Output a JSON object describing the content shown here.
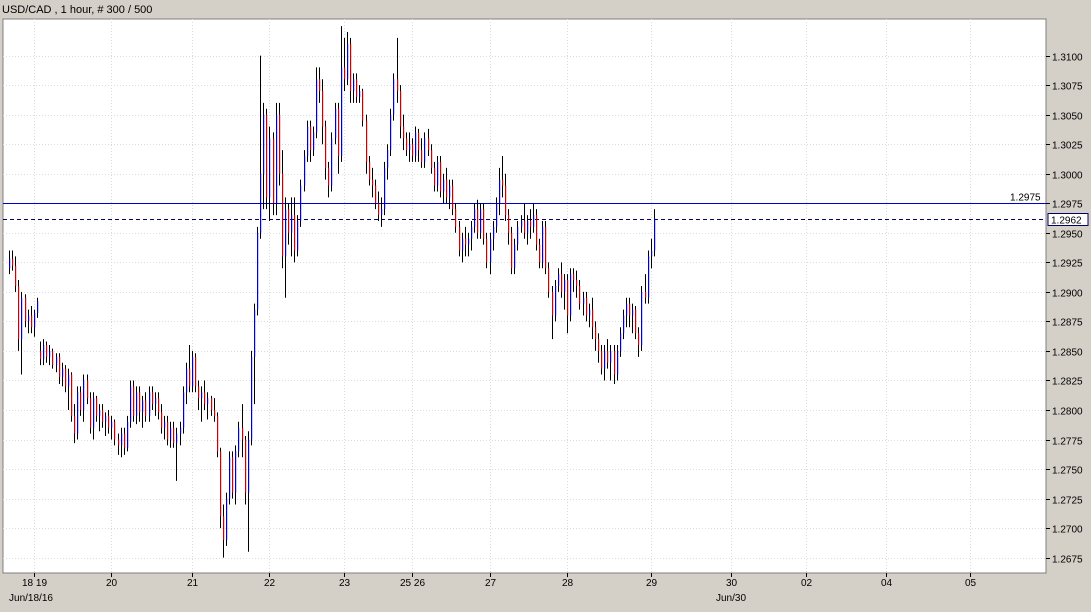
{
  "chart_data": {
    "type": "ohlc",
    "title": "USD/CAD , 1 hour, # 300 / 500",
    "ylim": [
      1.2662,
      1.3131
    ],
    "grid": true,
    "y_ticks": [
      "1.3100",
      "1.3075",
      "1.3050",
      "1.3025",
      "1.3000",
      "1.2975",
      "1.2950",
      "1.2925",
      "1.2900",
      "1.2875",
      "1.2850",
      "1.2825",
      "1.2800",
      "1.2775",
      "1.2750",
      "1.2725",
      "1.2700",
      "1.2675"
    ],
    "x_labels": [
      {
        "label": "18 19",
        "bar": 8
      },
      {
        "label": "20",
        "bar": 33
      },
      {
        "label": "21",
        "bar": 59
      },
      {
        "label": "22",
        "bar": 84
      },
      {
        "label": "23",
        "bar": 108
      },
      {
        "label": "25 26",
        "bar": 130
      },
      {
        "label": "27",
        "bar": 155
      },
      {
        "label": "28",
        "bar": 180
      },
      {
        "label": "29",
        "bar": 207
      },
      {
        "label": "30",
        "bar": 233
      },
      {
        "label": "02",
        "bar": 257
      },
      {
        "label": "04",
        "bar": 283
      },
      {
        "label": "05",
        "bar": 310
      }
    ],
    "x_labels2": [
      {
        "label": "Jun/18/16",
        "bar": 7
      },
      {
        "label": "Jun/30",
        "bar": 233
      }
    ],
    "reference_lines": [
      {
        "value": 1.2975,
        "label": "1.2975",
        "color": "#0000cc",
        "style": "solid"
      },
      {
        "value": 1.2962,
        "label": "1.2962",
        "color": "#000066",
        "style": "dashed"
      }
    ],
    "up_color": "#0000cc",
    "down_color": "#cc0000",
    "bars": [
      [
        1.292,
        1.2935,
        1.2915,
        1.2928
      ],
      [
        1.2928,
        1.2935,
        1.2918,
        1.2922
      ],
      [
        1.2922,
        1.293,
        1.29,
        1.2905
      ],
      [
        1.2905,
        1.291,
        1.285,
        1.286
      ],
      [
        1.286,
        1.29,
        1.283,
        1.2895
      ],
      [
        1.2895,
        1.2898,
        1.287,
        1.2875
      ],
      [
        1.2875,
        1.2885,
        1.2865,
        1.288
      ],
      [
        1.288,
        1.2888,
        1.2865,
        1.287
      ],
      [
        1.287,
        1.2885,
        1.2862,
        1.2882
      ],
      [
        1.2882,
        1.2895,
        1.2878,
        1.2892
      ],
      [
        1.285,
        1.2858,
        1.2838,
        1.2843
      ],
      [
        1.2843,
        1.286,
        1.2838,
        1.2855
      ],
      [
        1.2855,
        1.2858,
        1.284,
        1.2845
      ],
      [
        1.2845,
        1.2855,
        1.2838,
        1.285
      ],
      [
        1.285,
        1.2852,
        1.2835,
        1.2838
      ],
      [
        1.2838,
        1.2848,
        1.2832,
        1.2845
      ],
      [
        1.2845,
        1.2848,
        1.2822,
        1.2828
      ],
      [
        1.2828,
        1.284,
        1.282,
        1.2835
      ],
      [
        1.2835,
        1.2838,
        1.2815,
        1.282
      ],
      [
        1.282,
        1.2835,
        1.28,
        1.283
      ],
      [
        1.283,
        1.2832,
        1.279,
        1.2795
      ],
      [
        1.2795,
        1.2805,
        1.2772,
        1.278
      ],
      [
        1.278,
        1.282,
        1.2775,
        1.2815
      ],
      [
        1.2815,
        1.282,
        1.2795,
        1.28
      ],
      [
        1.28,
        1.283,
        1.279,
        1.2825
      ],
      [
        1.2825,
        1.283,
        1.2805,
        1.281
      ],
      [
        1.281,
        1.2815,
        1.278,
        1.2785
      ],
      [
        1.2785,
        1.2815,
        1.2775,
        1.281
      ],
      [
        1.281,
        1.2812,
        1.279,
        1.2795
      ],
      [
        1.2795,
        1.2805,
        1.2782,
        1.28
      ],
      [
        1.28,
        1.2805,
        1.2785,
        1.279
      ],
      [
        1.279,
        1.2798,
        1.2778,
        1.2795
      ],
      [
        1.2795,
        1.28,
        1.278,
        1.2785
      ],
      [
        1.2785,
        1.2795,
        1.2775,
        1.279
      ],
      [
        1.279,
        1.2792,
        1.277,
        1.2775
      ],
      [
        1.2775,
        1.278,
        1.2762,
        1.277
      ],
      [
        1.277,
        1.2785,
        1.276,
        1.278
      ],
      [
        1.278,
        1.2785,
        1.2762,
        1.2768
      ],
      [
        1.2768,
        1.2795,
        1.2765,
        1.279
      ],
      [
        1.279,
        1.2825,
        1.2785,
        1.282
      ],
      [
        1.282,
        1.2825,
        1.279,
        1.2795
      ],
      [
        1.2795,
        1.282,
        1.2788,
        1.2815
      ],
      [
        1.2815,
        1.282,
        1.279,
        1.2798
      ],
      [
        1.2798,
        1.2812,
        1.2785,
        1.2808
      ],
      [
        1.2808,
        1.2815,
        1.279,
        1.2795
      ],
      [
        1.2795,
        1.282,
        1.279,
        1.2815
      ],
      [
        1.2815,
        1.282,
        1.28,
        1.2805
      ],
      [
        1.2805,
        1.2815,
        1.2795,
        1.281
      ],
      [
        1.281,
        1.2815,
        1.2792,
        1.2798
      ],
      [
        1.2798,
        1.2805,
        1.278,
        1.2785
      ],
      [
        1.2785,
        1.2795,
        1.2775,
        1.279
      ],
      [
        1.279,
        1.2795,
        1.277,
        1.2775
      ],
      [
        1.2775,
        1.279,
        1.2768,
        1.2785
      ],
      [
        1.2785,
        1.279,
        1.2768,
        1.2772
      ],
      [
        1.2772,
        1.2785,
        1.274,
        1.278
      ],
      [
        1.278,
        1.279,
        1.277,
        1.2785
      ],
      [
        1.2785,
        1.282,
        1.278,
        1.2815
      ],
      [
        1.2815,
        1.284,
        1.2805,
        1.2835
      ],
      [
        1.2835,
        1.2855,
        1.2815,
        1.282
      ],
      [
        1.282,
        1.285,
        1.2815,
        1.2845
      ],
      [
        1.2845,
        1.2848,
        1.2815,
        1.282
      ],
      [
        1.282,
        1.2825,
        1.28,
        1.281
      ],
      [
        1.281,
        1.282,
        1.279,
        1.2815
      ],
      [
        1.2815,
        1.2825,
        1.28,
        1.2805
      ],
      [
        1.2805,
        1.2815,
        1.2792,
        1.281
      ],
      [
        1.281,
        1.2812,
        1.2795,
        1.28
      ],
      [
        1.28,
        1.281,
        1.279,
        1.2795
      ],
      [
        1.2795,
        1.2798,
        1.276,
        1.2765
      ],
      [
        1.2765,
        1.2768,
        1.27,
        1.271
      ],
      [
        1.271,
        1.272,
        1.2675,
        1.269
      ],
      [
        1.269,
        1.273,
        1.2685,
        1.2725
      ],
      [
        1.2725,
        1.2765,
        1.272,
        1.276
      ],
      [
        1.276,
        1.2765,
        1.2725,
        1.273
      ],
      [
        1.273,
        1.277,
        1.272,
        1.2765
      ],
      [
        1.2765,
        1.279,
        1.276,
        1.2785
      ],
      [
        1.2785,
        1.2805,
        1.276,
        1.2775
      ],
      [
        1.2775,
        1.2778,
        1.272,
        1.273
      ],
      [
        1.273,
        1.2782,
        1.268,
        1.2775
      ],
      [
        1.2775,
        1.285,
        1.277,
        1.2845
      ],
      [
        1.2845,
        1.289,
        1.2805,
        1.2885
      ],
      [
        1.2885,
        1.2955,
        1.288,
        1.295
      ],
      [
        1.295,
        1.31,
        1.2945,
        1.3
      ],
      [
        1.3,
        1.306,
        1.297,
        1.305
      ],
      [
        1.305,
        1.3055,
        1.297,
        1.298
      ],
      [
        1.298,
        1.304,
        1.296,
        1.303
      ],
      [
        1.303,
        1.3035,
        1.2965,
        1.2975
      ],
      [
        1.2975,
        1.306,
        1.2965,
        1.305
      ],
      [
        1.305,
        1.306,
        1.299,
        1.3
      ],
      [
        1.3,
        1.302,
        1.292,
        1.293
      ],
      [
        1.293,
        1.298,
        1.2895,
        1.297
      ],
      [
        1.297,
        1.2975,
        1.294,
        1.295
      ],
      [
        1.295,
        1.298,
        1.293,
        1.2965
      ],
      [
        1.2965,
        1.298,
        1.2925,
        1.2935
      ],
      [
        1.2935,
        1.2965,
        1.293,
        1.296
      ],
      [
        1.296,
        1.2995,
        1.2955,
        1.299
      ],
      [
        1.299,
        1.302,
        1.2985,
        1.3015
      ],
      [
        1.3015,
        1.3045,
        1.301,
        1.304
      ],
      [
        1.304,
        1.3045,
        1.301,
        1.302
      ],
      [
        1.302,
        1.304,
        1.3015,
        1.3035
      ],
      [
        1.3035,
        1.309,
        1.303,
        1.308
      ],
      [
        1.308,
        1.309,
        1.306,
        1.307
      ],
      [
        1.307,
        1.308,
        1.3025,
        1.304
      ],
      [
        1.304,
        1.3045,
        1.2995,
        1.3005
      ],
      [
        1.3005,
        1.301,
        1.298,
        1.299
      ],
      [
        1.299,
        1.3035,
        1.2985,
        1.303
      ],
      [
        1.303,
        1.306,
        1.3025,
        1.3055
      ],
      [
        1.3055,
        1.306,
        1.3,
        1.3015
      ],
      [
        1.3015,
        1.3125,
        1.301,
        1.309
      ],
      [
        1.309,
        1.3115,
        1.307,
        1.308
      ],
      [
        1.308,
        1.312,
        1.3075,
        1.311
      ],
      [
        1.311,
        1.3115,
        1.306,
        1.307
      ],
      [
        1.307,
        1.3085,
        1.306,
        1.308
      ],
      [
        1.308,
        1.3085,
        1.306,
        1.3065
      ],
      [
        1.3065,
        1.3075,
        1.306,
        1.307
      ],
      [
        1.307,
        1.3072,
        1.304,
        1.3045
      ],
      [
        1.3045,
        1.305,
        1.3,
        1.301
      ],
      [
        1.301,
        1.3015,
        1.299,
        1.2995
      ],
      [
        1.2995,
        1.3005,
        1.298,
        1.299
      ],
      [
        1.299,
        1.2995,
        1.297,
        1.2975
      ],
      [
        1.2975,
        1.2985,
        1.296,
        1.2965
      ],
      [
        1.2965,
        1.298,
        1.2955,
        1.297
      ],
      [
        1.297,
        1.301,
        1.2965,
        1.3005
      ],
      [
        1.3005,
        1.3025,
        1.2995,
        1.302
      ],
      [
        1.302,
        1.3055,
        1.3015,
        1.305
      ],
      [
        1.305,
        1.3085,
        1.3045,
        1.308
      ],
      [
        1.308,
        1.3115,
        1.306,
        1.307
      ],
      [
        1.307,
        1.3075,
        1.303,
        1.304
      ],
      [
        1.304,
        1.305,
        1.302,
        1.303
      ],
      [
        1.303,
        1.3035,
        1.3015,
        1.302
      ],
      [
        1.302,
        1.3035,
        1.301,
        1.3025
      ],
      [
        1.3025,
        1.303,
        1.301,
        1.3015
      ],
      [
        1.3015,
        1.304,
        1.301,
        1.3035
      ],
      [
        1.3035,
        1.3038,
        1.301,
        1.302
      ],
      [
        1.302,
        1.303,
        1.3005,
        1.301
      ],
      [
        1.301,
        1.3035,
        1.3005,
        1.303
      ],
      [
        1.303,
        1.3038,
        1.3015,
        1.302
      ],
      [
        1.302,
        1.3025,
        1.3,
        1.3005
      ],
      [
        1.3005,
        1.301,
        1.2985,
        1.299
      ],
      [
        1.299,
        1.3015,
        1.2985,
        1.301
      ],
      [
        1.301,
        1.3015,
        1.298,
        1.2985
      ],
      [
        1.2985,
        1.3,
        1.2975,
        1.2995
      ],
      [
        1.2995,
        1.3005,
        1.2975,
        1.298
      ],
      [
        1.298,
        1.2995,
        1.297,
        1.299
      ],
      [
        1.299,
        1.2995,
        1.2965,
        1.297
      ],
      [
        1.297,
        1.2975,
        1.295,
        1.2955
      ],
      [
        1.2955,
        1.296,
        1.293,
        1.2935
      ],
      [
        1.2935,
        1.295,
        1.2925,
        1.2945
      ],
      [
        1.2945,
        1.2955,
        1.293,
        1.294
      ],
      [
        1.294,
        1.295,
        1.293,
        1.2945
      ],
      [
        1.2945,
        1.296,
        1.2935,
        1.2955
      ],
      [
        1.2955,
        1.2975,
        1.295,
        1.297
      ],
      [
        1.297,
        1.2978,
        1.2945,
        1.295
      ],
      [
        1.295,
        1.2975,
        1.2945,
        1.297
      ],
      [
        1.297,
        1.2975,
        1.294,
        1.2945
      ],
      [
        1.2945,
        1.295,
        1.292,
        1.2925
      ],
      [
        1.2925,
        1.295,
        1.2915,
        1.2945
      ],
      [
        1.2945,
        1.296,
        1.2935,
        1.2955
      ],
      [
        1.2955,
        1.298,
        1.295,
        1.2975
      ],
      [
        1.2975,
        1.3005,
        1.2965,
        1.2995
      ],
      [
        1.2995,
        1.3015,
        1.298,
        1.299
      ],
      [
        1.299,
        1.3,
        1.296,
        1.2965
      ],
      [
        1.2965,
        1.297,
        1.294,
        1.295
      ],
      [
        1.295,
        1.2955,
        1.2915,
        1.292
      ],
      [
        1.292,
        1.2945,
        1.2915,
        1.294
      ],
      [
        1.294,
        1.296,
        1.2935,
        1.2955
      ],
      [
        1.2955,
        1.2965,
        1.295,
        1.296
      ],
      [
        1.296,
        1.2975,
        1.2945,
        1.295
      ],
      [
        1.295,
        1.2965,
        1.294,
        1.296
      ],
      [
        1.296,
        1.297,
        1.2945,
        1.2955
      ],
      [
        1.2955,
        1.2975,
        1.295,
        1.2965
      ],
      [
        1.2965,
        1.297,
        1.2935,
        1.294
      ],
      [
        1.294,
        1.2945,
        1.292,
        1.2925
      ],
      [
        1.2925,
        1.296,
        1.292,
        1.2955
      ],
      [
        1.2955,
        1.296,
        1.2915,
        1.292
      ],
      [
        1.292,
        1.2925,
        1.2895,
        1.29
      ],
      [
        1.29,
        1.2905,
        1.286,
        1.288
      ],
      [
        1.288,
        1.291,
        1.2875,
        1.2905
      ],
      [
        1.2905,
        1.292,
        1.29,
        1.2915
      ],
      [
        1.2915,
        1.2925,
        1.2895,
        1.29
      ],
      [
        1.29,
        1.2915,
        1.2885,
        1.291
      ],
      [
        1.291,
        1.2915,
        1.2865,
        1.288
      ],
      [
        1.288,
        1.292,
        1.2875,
        1.2915
      ],
      [
        1.2915,
        1.292,
        1.29,
        1.291
      ],
      [
        1.291,
        1.2918,
        1.2895,
        1.2905
      ],
      [
        1.2905,
        1.291,
        1.2885,
        1.289
      ],
      [
        1.289,
        1.29,
        1.288,
        1.2895
      ],
      [
        1.2895,
        1.29,
        1.2875,
        1.288
      ],
      [
        1.288,
        1.289,
        1.287,
        1.2885
      ],
      [
        1.2885,
        1.2895,
        1.286,
        1.287
      ],
      [
        1.287,
        1.2875,
        1.285,
        1.286
      ],
      [
        1.286,
        1.2865,
        1.284,
        1.285
      ],
      [
        1.285,
        1.2855,
        1.283,
        1.2835
      ],
      [
        1.2835,
        1.2855,
        1.2825,
        1.285
      ],
      [
        1.285,
        1.286,
        1.2835,
        1.284
      ],
      [
        1.284,
        1.2855,
        1.2825,
        1.285
      ],
      [
        1.285,
        1.2855,
        1.2822,
        1.283
      ],
      [
        1.283,
        1.2855,
        1.2825,
        1.285
      ],
      [
        1.285,
        1.287,
        1.2845,
        1.2865
      ],
      [
        1.2865,
        1.2885,
        1.286,
        1.288
      ],
      [
        1.288,
        1.2895,
        1.287,
        1.289
      ],
      [
        1.289,
        1.2895,
        1.287,
        1.288
      ],
      [
        1.288,
        1.289,
        1.2865,
        1.2885
      ],
      [
        1.2885,
        1.2888,
        1.286,
        1.2865
      ],
      [
        1.2865,
        1.287,
        1.2845,
        1.2855
      ],
      [
        1.2855,
        1.2905,
        1.285,
        1.29
      ],
      [
        1.29,
        1.2915,
        1.289,
        1.2895
      ],
      [
        1.2895,
        1.2935,
        1.289,
        1.293
      ],
      [
        1.293,
        1.2945,
        1.292,
        1.2935
      ],
      [
        1.2935,
        1.297,
        1.293,
        1.2962
      ]
    ]
  }
}
